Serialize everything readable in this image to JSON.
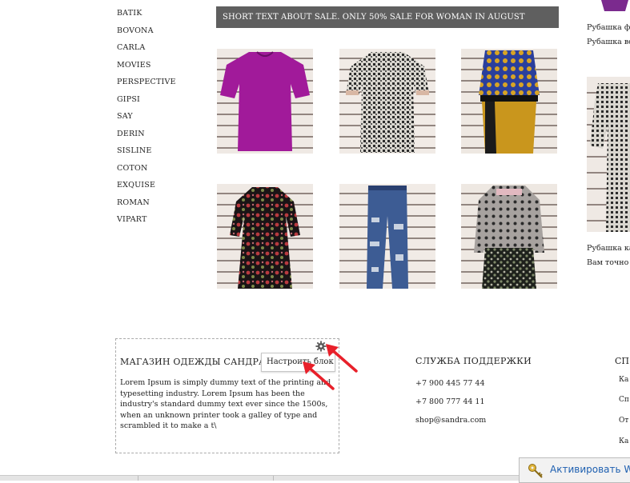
{
  "brands": [
    "BATIK",
    "BOVONA",
    "CARLA",
    "MOVIES",
    "PERSPECTIVE",
    "GIPSI",
    "SAY",
    "DERIN",
    "SISLINE",
    "COTON",
    "EXQUISE",
    "ROMAN",
    "VIPART"
  ],
  "banner": {
    "text": "SHORT TEXT ABOUT SALE. ONLY 50% SALE FOR WOMAN IN AUGUST"
  },
  "side_products": [
    {
      "title": "Рубашка ф",
      "subtitle": "Рубашка во"
    },
    {
      "title": "Рубашка ка",
      "subtitle": "Вам точно"
    }
  ],
  "footer": {
    "shop_title": "МАГАЗИН ОДЕЖДЫ САНДРА",
    "description": "Lorem Ipsum is simply dummy text of the printing and typesetting industry. Lorem Ipsum has been the industry's standard dummy text ever since the 1500s, when an unknown printer took a galley of type and scrambled it to make a t\\",
    "settings_label": "Настроить блок",
    "support_title": "СЛУЖБА ПОДДЕРЖКИ",
    "phone1": "+7 900 445 77 44",
    "phone2": "+7 800 777 44 11",
    "email": "shop@sandra.com",
    "third_title": "СП",
    "third_items": [
      "Ка",
      "Сп",
      "От",
      "Ка"
    ]
  },
  "activate": {
    "text": "Активировать Wi"
  },
  "colors": {
    "banner_bg": "#5f5f5f",
    "arrow": "#e8202a",
    "link": "#1d5fb0"
  }
}
